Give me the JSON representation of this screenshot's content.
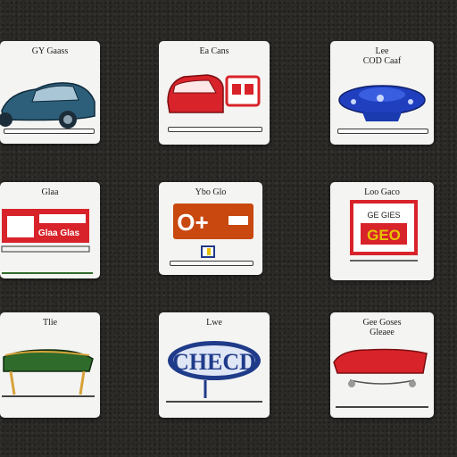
{
  "grid": {
    "cards": [
      {
        "title": "GY Gaass",
        "icon": "sedan-car-icon"
      },
      {
        "title": "Ea Cans",
        "icon": "red-minivan-icon"
      },
      {
        "title": "Lee\nCOD Caaf",
        "icon": "blue-flying-saucer-car-icon"
      },
      {
        "title": "Glaa",
        "icon": "red-dashboard-icon",
        "sign_text": "Glaa Glas"
      },
      {
        "title": "Ybo Glo",
        "icon": "orange-sign-icon",
        "sign_text": "O+"
      },
      {
        "title": "Loo Gaco",
        "icon": "red-sign-board-icon",
        "sign_text": "GE GIES",
        "sign_big": "GEO"
      },
      {
        "title": "Tlie",
        "icon": "green-cart-icon"
      },
      {
        "title": "Lwe",
        "icon": "blue-oval-sign-icon",
        "sign_text": "CHECD"
      },
      {
        "title": "Gee Goses\nGleaee",
        "icon": "red-car-top-icon"
      }
    ]
  },
  "colors": {
    "background": "#2b2a27",
    "card": "#f4f4f2",
    "red": "#d8232a",
    "blue": "#1f3b8a",
    "green": "#2f6b2a",
    "orange": "#c8480f",
    "teal": "#2d5f7a"
  }
}
